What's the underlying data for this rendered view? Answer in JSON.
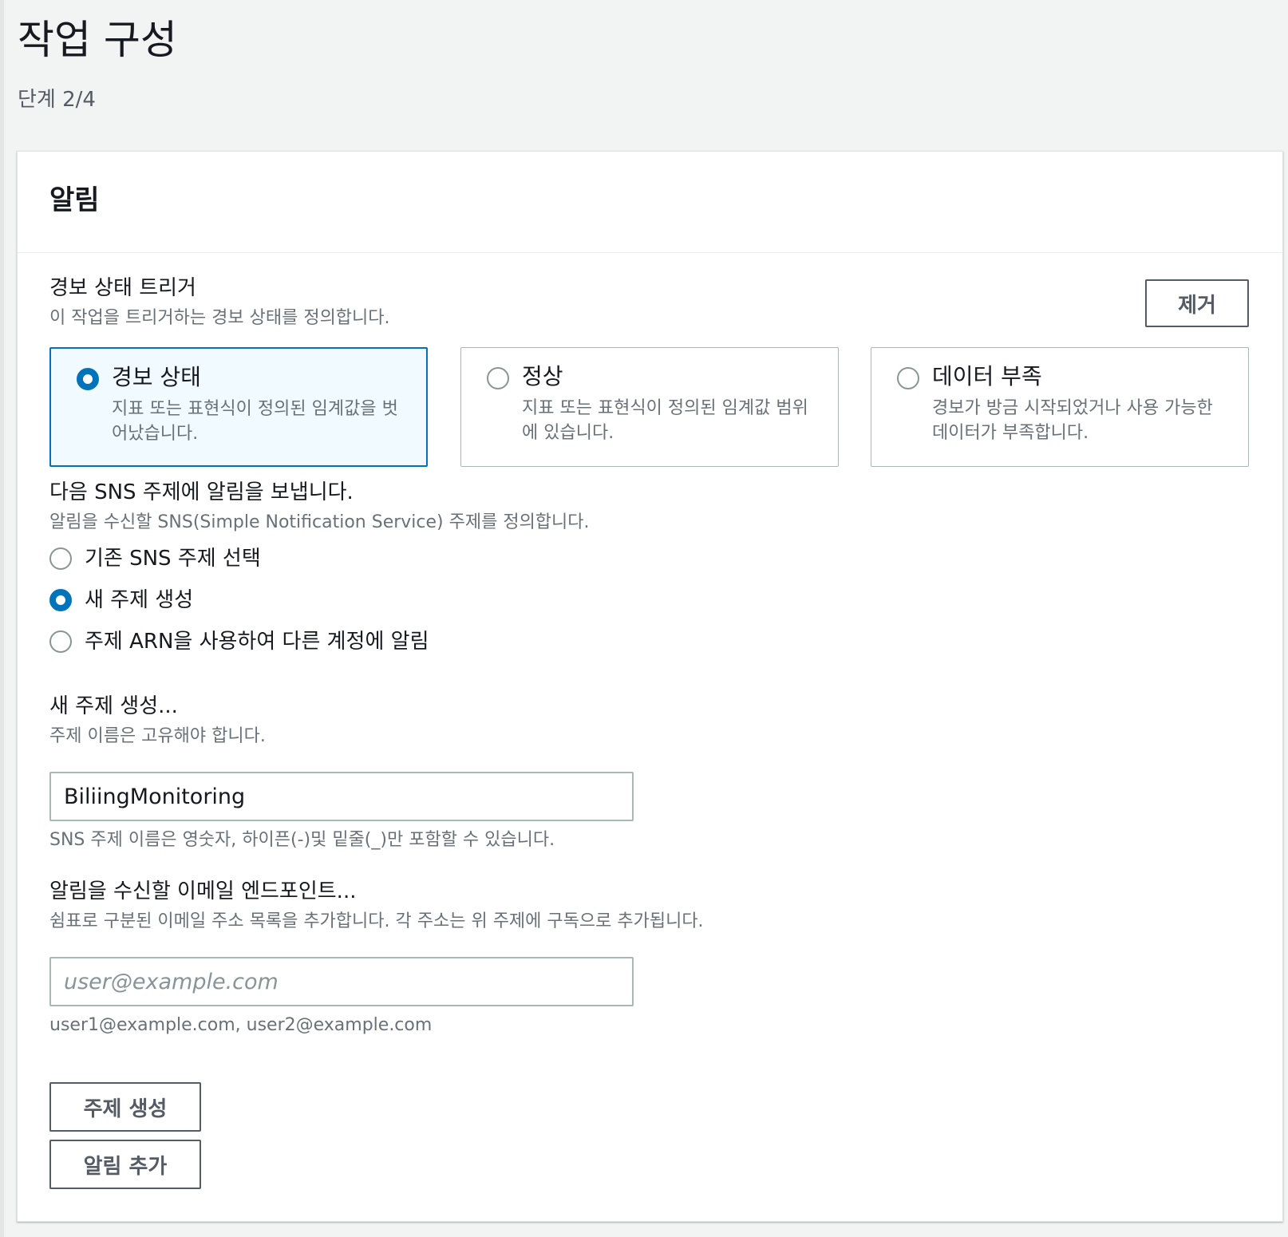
{
  "page": {
    "title": "작업 구성",
    "step": "단계 2/4"
  },
  "panel": {
    "title": "알림",
    "remove_label": "제거",
    "trigger": {
      "label": "경보 상태 트리거",
      "description": "이 작업을 트리거하는 경보 상태를 정의합니다.",
      "options": [
        {
          "title": "경보 상태",
          "description": "지표 또는 표현식이 정의된 임계값을 벗어났습니다.",
          "selected": true
        },
        {
          "title": "정상",
          "description": "지표 또는 표현식이 정의된 임계값 범위에 있습니다.",
          "selected": false
        },
        {
          "title": "데이터 부족",
          "description": "경보가 방금 시작되었거나 사용 가능한 데이터가 부족합니다.",
          "selected": false
        }
      ]
    },
    "sns": {
      "label": "다음 SNS 주제에 알림을 보냅니다.",
      "description": "알림을 수신할 SNS(Simple Notification Service) 주제를 정의합니다.",
      "options": [
        {
          "label": "기존 SNS 주제 선택",
          "selected": false
        },
        {
          "label": "새 주제 생성",
          "selected": true
        },
        {
          "label": "주제 ARN을 사용하여 다른 계정에 알림",
          "selected": false
        }
      ]
    },
    "new_topic": {
      "label": "새 주제 생성...",
      "description": "주제 이름은 고유해야 합니다.",
      "value": "BiliingMonitoring",
      "constraint": "SNS 주제 이름은 영숫자, 하이픈(-)및 밑줄(_)만 포함할 수 있습니다."
    },
    "email": {
      "label": "알림을 수신할 이메일 엔드포인트...",
      "description": "쉼표로 구분된 이메일 주소 목록을 추가합니다. 각 주소는 위 주제에 구독으로 추가됩니다.",
      "value": "",
      "placeholder": "user@example.com",
      "hint": "user1@example.com, user2@example.com"
    },
    "create_topic_label": "주제 생성",
    "add_notification_label": "알림 추가"
  },
  "colors": {
    "accent": "#0073bb",
    "page_background": "#f2f3f3",
    "selected_tile_background": "#f1faff"
  }
}
